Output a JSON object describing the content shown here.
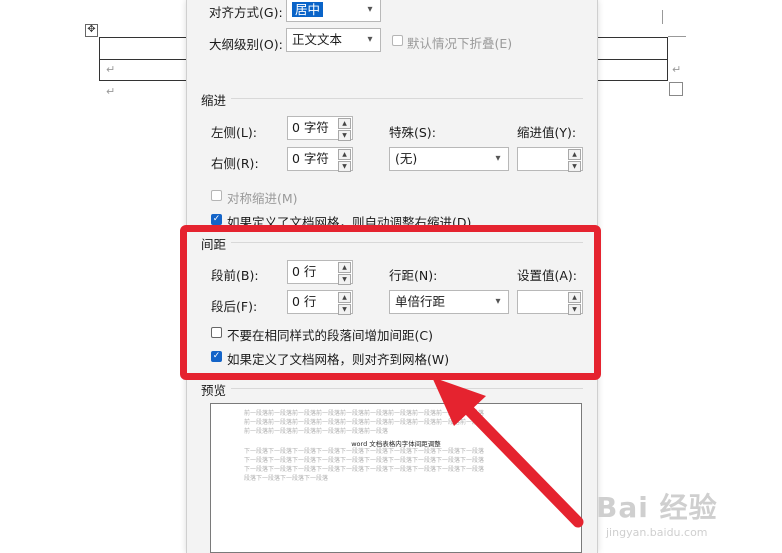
{
  "dialog": {
    "alignment": {
      "label": "对齐方式(G):",
      "value": "居中"
    },
    "outline_level": {
      "label": "大纲级别(O):",
      "value": "正文文本",
      "collapse_label": "默认情况下折叠(E)"
    },
    "indent": {
      "title": "缩进",
      "left_label": "左侧(L):",
      "left_value": "0 字符",
      "right_label": "右侧(R):",
      "right_value": "0 字符",
      "special_label": "特殊(S):",
      "special_value": "(无)",
      "indent_value_label": "缩进值(Y):",
      "mirror_label": "对称缩进(M)",
      "auto_adjust_label": "如果定义了文档网格，则自动调整右缩进(D)"
    },
    "spacing": {
      "title": "间距",
      "before_label": "段前(B):",
      "before_value": "0 行",
      "after_label": "段后(F):",
      "after_value": "0 行",
      "line_spacing_label": "行距(N):",
      "line_spacing_value": "单倍行距",
      "set_value_label": "设置值(A):",
      "no_space_same_style_label": "不要在相同样式的段落间增加间距(C)",
      "snap_grid_label": "如果定义了文档网格，则对齐到网格(W)"
    },
    "preview": {
      "title": "预览",
      "prev_lines": [
        "前一段落前一段落前一段落前一段落前一段落前一段落前一段落前一段落前一段落前一段落",
        "前一段落前一段落前一段落前一段落前一段落前一段落前一段落前一段落前一段落前一段落",
        "前一段落前一段落前一段落前一段落前一段落前一段落"
      ],
      "sample_text": "word 文档表格内字体间距调整",
      "next_lines": [
        "下一段落下一段落下一段落下一段落下一段落下一段落下一段落下一段落下一段落下一段落",
        "下一段落下一段落下一段落下一段落下一段落下一段落下一段落下一段落下一段落下一段落",
        "下一段落下一段落下一段落下一段落下一段落下一段落下一段落下一段落下一段落下一段落",
        "段落下一段落下一段落下一段落"
      ]
    }
  },
  "document": {
    "paragraph_mark": "↵",
    "move_handle": "✥"
  },
  "watermark": {
    "logo": "Bai 经验",
    "url": "jingyan.baidu.com"
  },
  "colors": {
    "highlight": "#e5232f",
    "selection": "#0a64c8",
    "checkbox": "#1464c8"
  }
}
